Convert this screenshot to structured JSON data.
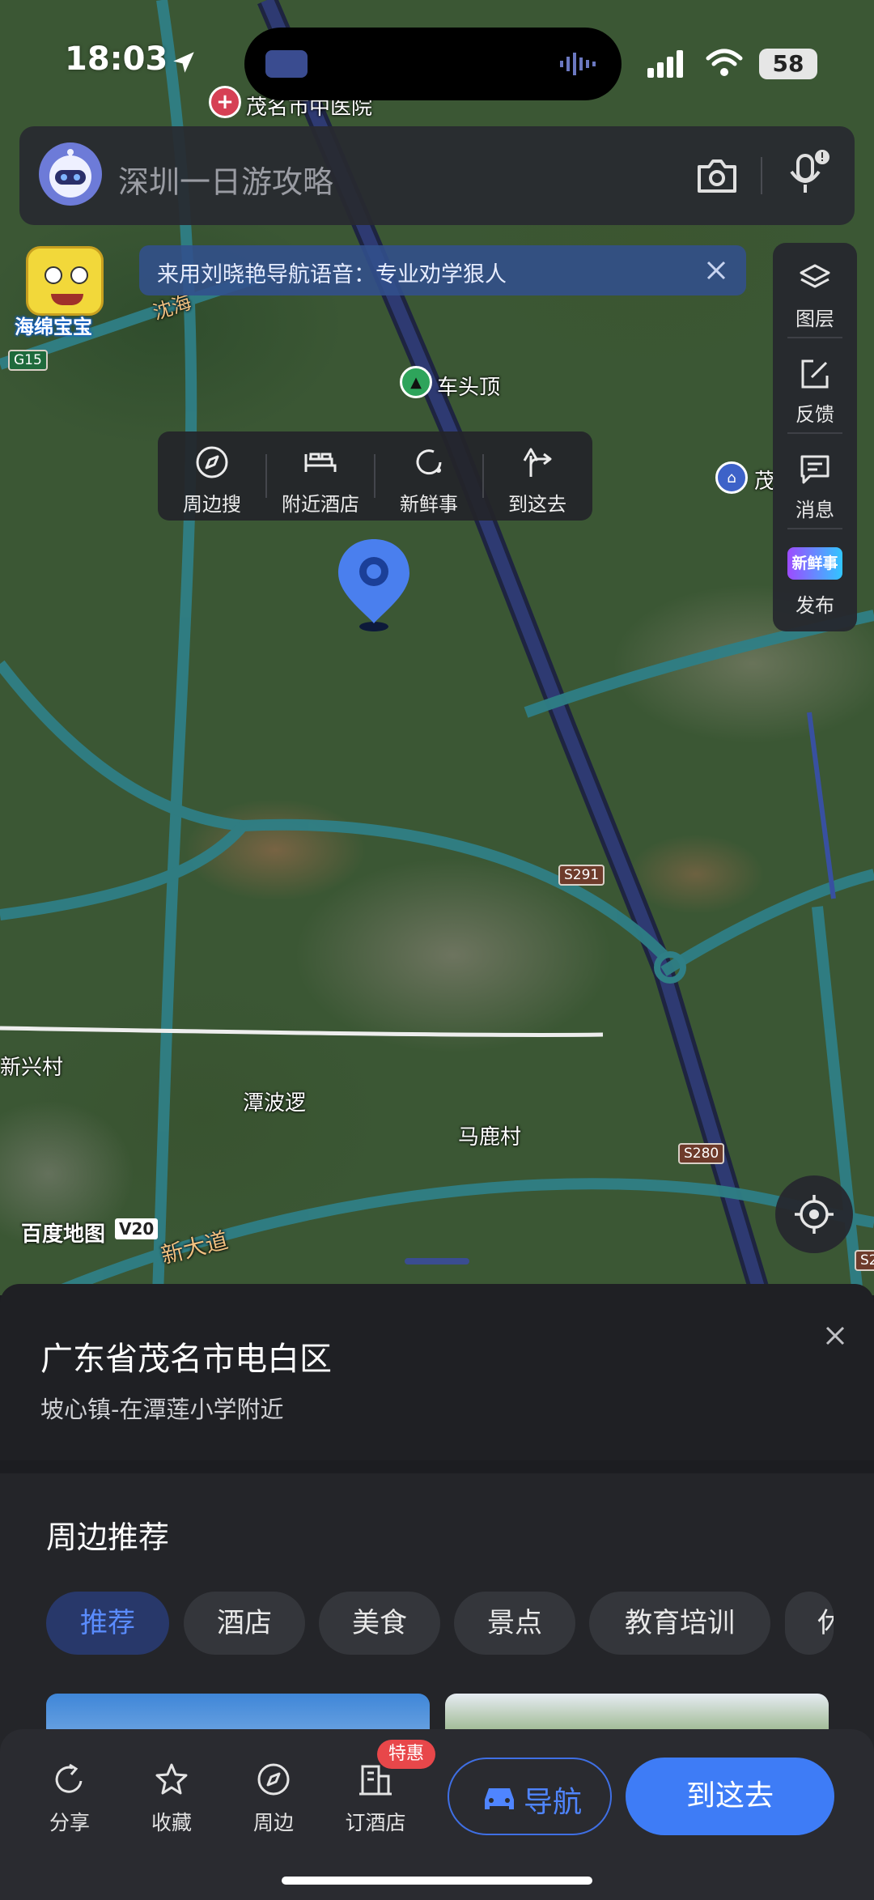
{
  "status_bar": {
    "time": "18:03",
    "battery": "58"
  },
  "search": {
    "placeholder": "深圳一日游攻略"
  },
  "banner": {
    "text": "来用刘晓艳导航语音：专业劝学狠人"
  },
  "mascot": {
    "label": "海绵宝宝"
  },
  "side_tools": [
    {
      "label": "图层",
      "icon": "layers-icon"
    },
    {
      "label": "反馈",
      "icon": "feedback-edit-icon"
    },
    {
      "label": "消息",
      "icon": "message-icon"
    },
    {
      "label": "发布",
      "icon": "new-post-icon",
      "badge_text": "新鲜事"
    }
  ],
  "popup_actions": [
    {
      "label": "周边搜",
      "icon": "compass-icon"
    },
    {
      "label": "附近酒店",
      "icon": "bed-icon"
    },
    {
      "label": "新鲜事",
      "icon": "refresh-icon"
    },
    {
      "label": "到这去",
      "icon": "turn-arrow-icon"
    }
  ],
  "map_labels": {
    "hospital": "茂名市中医院",
    "peak": "车头顶",
    "right_poi": "茂",
    "village1": "新兴村",
    "village2": "潭波逻",
    "village3": "马鹿村",
    "road_left": "沈海",
    "avenue": "新大道",
    "watermark": "百度地图",
    "version": "V20",
    "road_g15": "G15",
    "road_s291": "S291",
    "road_s280": "S280",
    "road_s2_edge": "S2"
  },
  "place": {
    "title": "广东省茂名市电白区",
    "subtitle": "坡心镇-在潭莲小学附近"
  },
  "nearby": {
    "title": "周边推荐",
    "chips": [
      "推荐",
      "酒店",
      "美食",
      "景点",
      "教育培训",
      "休"
    ]
  },
  "action_bar": {
    "share": "分享",
    "favorite": "收藏",
    "nearby": "周边",
    "hotel": "订酒店",
    "deal_badge": "特惠",
    "navigate": "导航",
    "go": "到这去"
  },
  "colors": {
    "accent": "#3e7cf6",
    "road": "#4a9a9a",
    "highway": "#2a3560"
  }
}
